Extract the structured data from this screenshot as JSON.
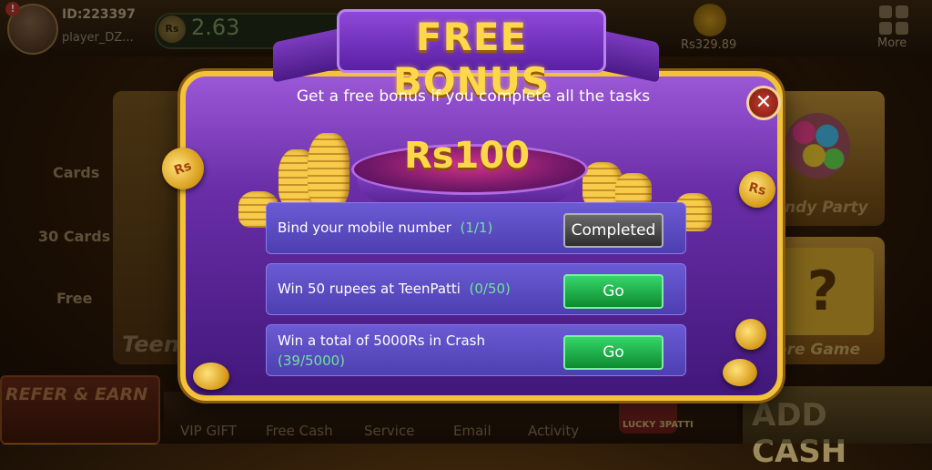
{
  "lobby": {
    "player_id": "ID:223397",
    "player_name": "player_DZ...",
    "balance": "2.63",
    "balance_currency_icon": "Rs",
    "secondary_balance": "Rs329.89",
    "more_label": "More",
    "side_items": [
      "Cards",
      "30 Cards",
      "Free"
    ],
    "game_cards": [
      "Teen P",
      "Candy Party",
      "More Game"
    ],
    "refer_label": "REFER & EARN",
    "bottom_nav": [
      "VIP GIFT",
      "Free Cash",
      "Service",
      "Email",
      "Activity"
    ],
    "lucky_label": "LUCKY 3PATTI",
    "add_cash_label": "ADD CASH"
  },
  "dialog": {
    "title": "FREE BONUS",
    "subtitle": "Get a free bonus if you complete all the tasks",
    "prize": "Rs100",
    "close_icon": "close-icon",
    "coin_label": "Rs",
    "tasks": [
      {
        "text": "Bind your mobile number",
        "progress": "(1/1)",
        "button": "Completed",
        "state": "completed"
      },
      {
        "text": "Win 50 rupees at TeenPatti",
        "progress": "(0/50)",
        "button": "Go",
        "state": "go"
      },
      {
        "text": "Win a total of 5000Rs in Crash",
        "progress": "(39/5000)",
        "button": "Go",
        "state": "go"
      }
    ]
  },
  "colors": {
    "accent_gold": "#ffd84a",
    "dialog_purple": "#6a2ea8",
    "go_green": "#1fb04a",
    "progress_green": "#6fe39a"
  }
}
